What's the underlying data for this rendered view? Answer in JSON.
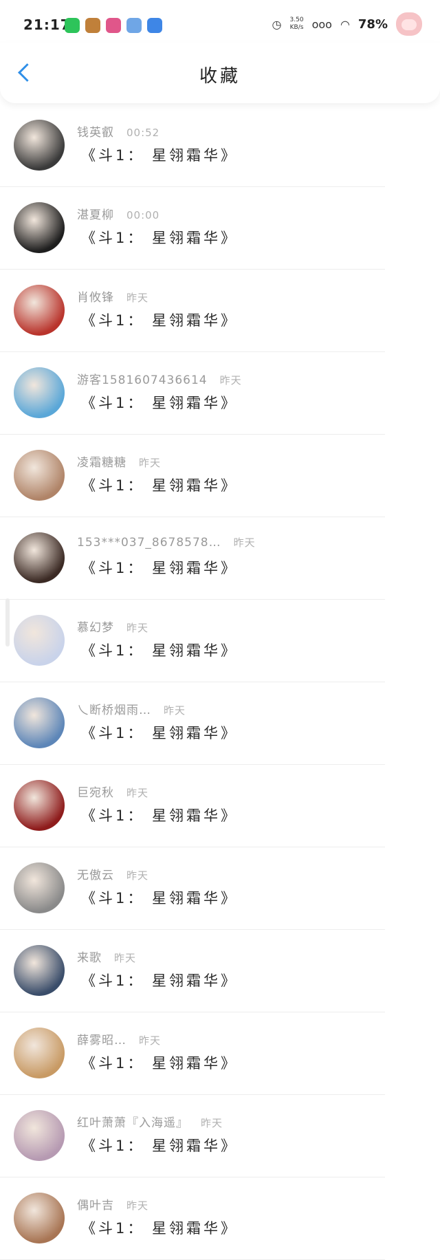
{
  "status_bar": {
    "time": "21:17",
    "net_speed_value": "3.50",
    "net_speed_unit": "KB/s",
    "signal_text": "ooo",
    "battery": "78%",
    "icons": [
      "wechat-icon",
      "game-icon",
      "app-icon",
      "cloud-icon",
      "feather-icon",
      "alarm-icon",
      "signal-icon",
      "wifi-icon"
    ],
    "app_colors": [
      "#2dc45a",
      "#c0803a",
      "#e0568a",
      "#6fa6e6",
      "#3e86e6"
    ]
  },
  "header": {
    "title": "收藏",
    "back_icon": "chevron-left-icon",
    "accent_color": "#2f8fe8"
  },
  "items": [
    {
      "name": "钱英叡",
      "time": "00:52",
      "content": "《斗1： 星翎霜华》",
      "avatar_color": "#3a3a3a"
    },
    {
      "name": "湛夏柳",
      "time": "00:00",
      "content": "《斗1： 星翎霜华》",
      "avatar_color": "#1e1e1e"
    },
    {
      "name": "肖攸锋",
      "time": "昨天",
      "content": "《斗1： 星翎霜华》",
      "avatar_color": "#b9342c"
    },
    {
      "name": "游客1581607436614",
      "time": "昨天",
      "content": "《斗1： 星翎霜华》",
      "avatar_color": "#5aa7d8"
    },
    {
      "name": "凌霜糖糖",
      "time": "昨天",
      "content": "《斗1： 星翎霜华》",
      "avatar_color": "#b08468"
    },
    {
      "name": "153***037_8678578…",
      "time": "昨天",
      "content": "《斗1： 星翎霜华》",
      "avatar_color": "#3b2a24"
    },
    {
      "name": "慕幻梦",
      "time": "昨天",
      "content": "《斗1： 星翎霜华》",
      "avatar_color": "#c9d3ea"
    },
    {
      "name": "乀断桥烟雨…",
      "time": "昨天",
      "content": "《斗1： 星翎霜华》",
      "avatar_color": "#5d86b8"
    },
    {
      "name": "巨宛秋",
      "time": "昨天",
      "content": "《斗1： 星翎霜华》",
      "avatar_color": "#8e1c1c"
    },
    {
      "name": "无傲云",
      "time": "昨天",
      "content": "《斗1： 星翎霜华》",
      "avatar_color": "#8a8a8a"
    },
    {
      "name": "来歌",
      "time": "昨天",
      "content": "《斗1： 星翎霜华》",
      "avatar_color": "#3a4d6a"
    },
    {
      "name": "薛雾昭…",
      "time": "昨天",
      "content": "《斗1： 星翎霜华》",
      "avatar_color": "#c89a64"
    },
    {
      "name": "红叶萧萧『入海遥』",
      "time": "昨天",
      "content": "《斗1： 星翎霜华》",
      "avatar_color": "#b69ab2"
    },
    {
      "name": "偶叶吉",
      "time": "昨天",
      "content": "《斗1： 星翎霜华》",
      "avatar_color": "#a87554"
    }
  ]
}
